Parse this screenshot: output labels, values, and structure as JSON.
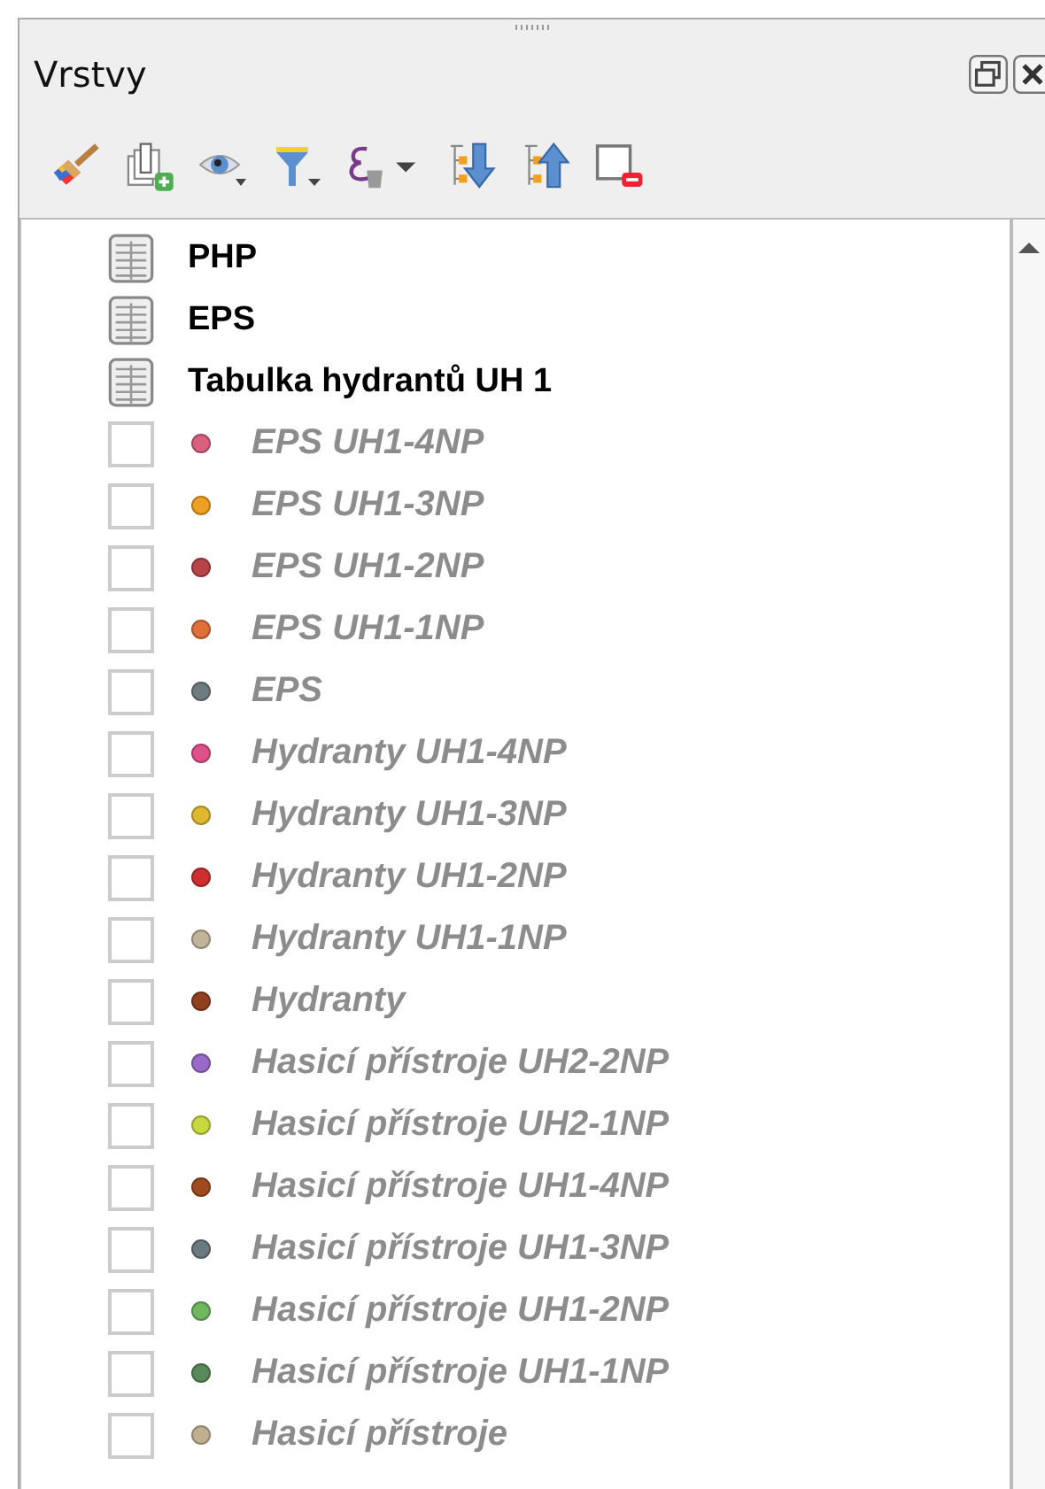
{
  "panel": {
    "title": "Vrstvy"
  },
  "layers": [
    {
      "kind": "table",
      "name": "PHP"
    },
    {
      "kind": "table",
      "name": "EPS"
    },
    {
      "kind": "table",
      "name": "Tabulka hydrantů UH 1"
    },
    {
      "kind": "layer",
      "name": "EPS UH1-4NP",
      "checked": false,
      "color": "#d9607e"
    },
    {
      "kind": "layer",
      "name": "EPS UH1-3NP",
      "checked": false,
      "color": "#f0a020"
    },
    {
      "kind": "layer",
      "name": "EPS UH1-2NP",
      "checked": false,
      "color": "#b84448"
    },
    {
      "kind": "layer",
      "name": "EPS UH1-1NP",
      "checked": false,
      "color": "#e0703a"
    },
    {
      "kind": "layer",
      "name": "EPS",
      "checked": false,
      "color": "#6e7c80"
    },
    {
      "kind": "layer",
      "name": "Hydranty UH1-4NP",
      "checked": false,
      "color": "#e0508a"
    },
    {
      "kind": "layer",
      "name": "Hydranty UH1-3NP",
      "checked": false,
      "color": "#e0b830"
    },
    {
      "kind": "layer",
      "name": "Hydranty UH1-2NP",
      "checked": false,
      "color": "#cc3030"
    },
    {
      "kind": "layer",
      "name": "Hydranty UH1-1NP",
      "checked": false,
      "color": "#c0b49a"
    },
    {
      "kind": "layer",
      "name": "Hydranty",
      "checked": false,
      "color": "#904020"
    },
    {
      "kind": "layer",
      "name": "Hasicí přístroje UH2-2NP",
      "checked": false,
      "color": "#9a6ac8"
    },
    {
      "kind": "layer",
      "name": "Hasicí přístroje UH2-1NP",
      "checked": false,
      "color": "#c8d840"
    },
    {
      "kind": "layer",
      "name": "Hasicí přístroje UH1-4NP",
      "checked": false,
      "color": "#a04a20"
    },
    {
      "kind": "layer",
      "name": "Hasicí přístroje UH1-3NP",
      "checked": false,
      "color": "#6a7a80"
    },
    {
      "kind": "layer",
      "name": "Hasicí přístroje UH1-2NP",
      "checked": false,
      "color": "#70b860"
    },
    {
      "kind": "layer",
      "name": "Hasicí přístroje UH1-1NP",
      "checked": false,
      "color": "#5a8a5a"
    },
    {
      "kind": "layer",
      "name": "Hasicí přístroje",
      "checked": false,
      "color": "#c0b090"
    }
  ]
}
